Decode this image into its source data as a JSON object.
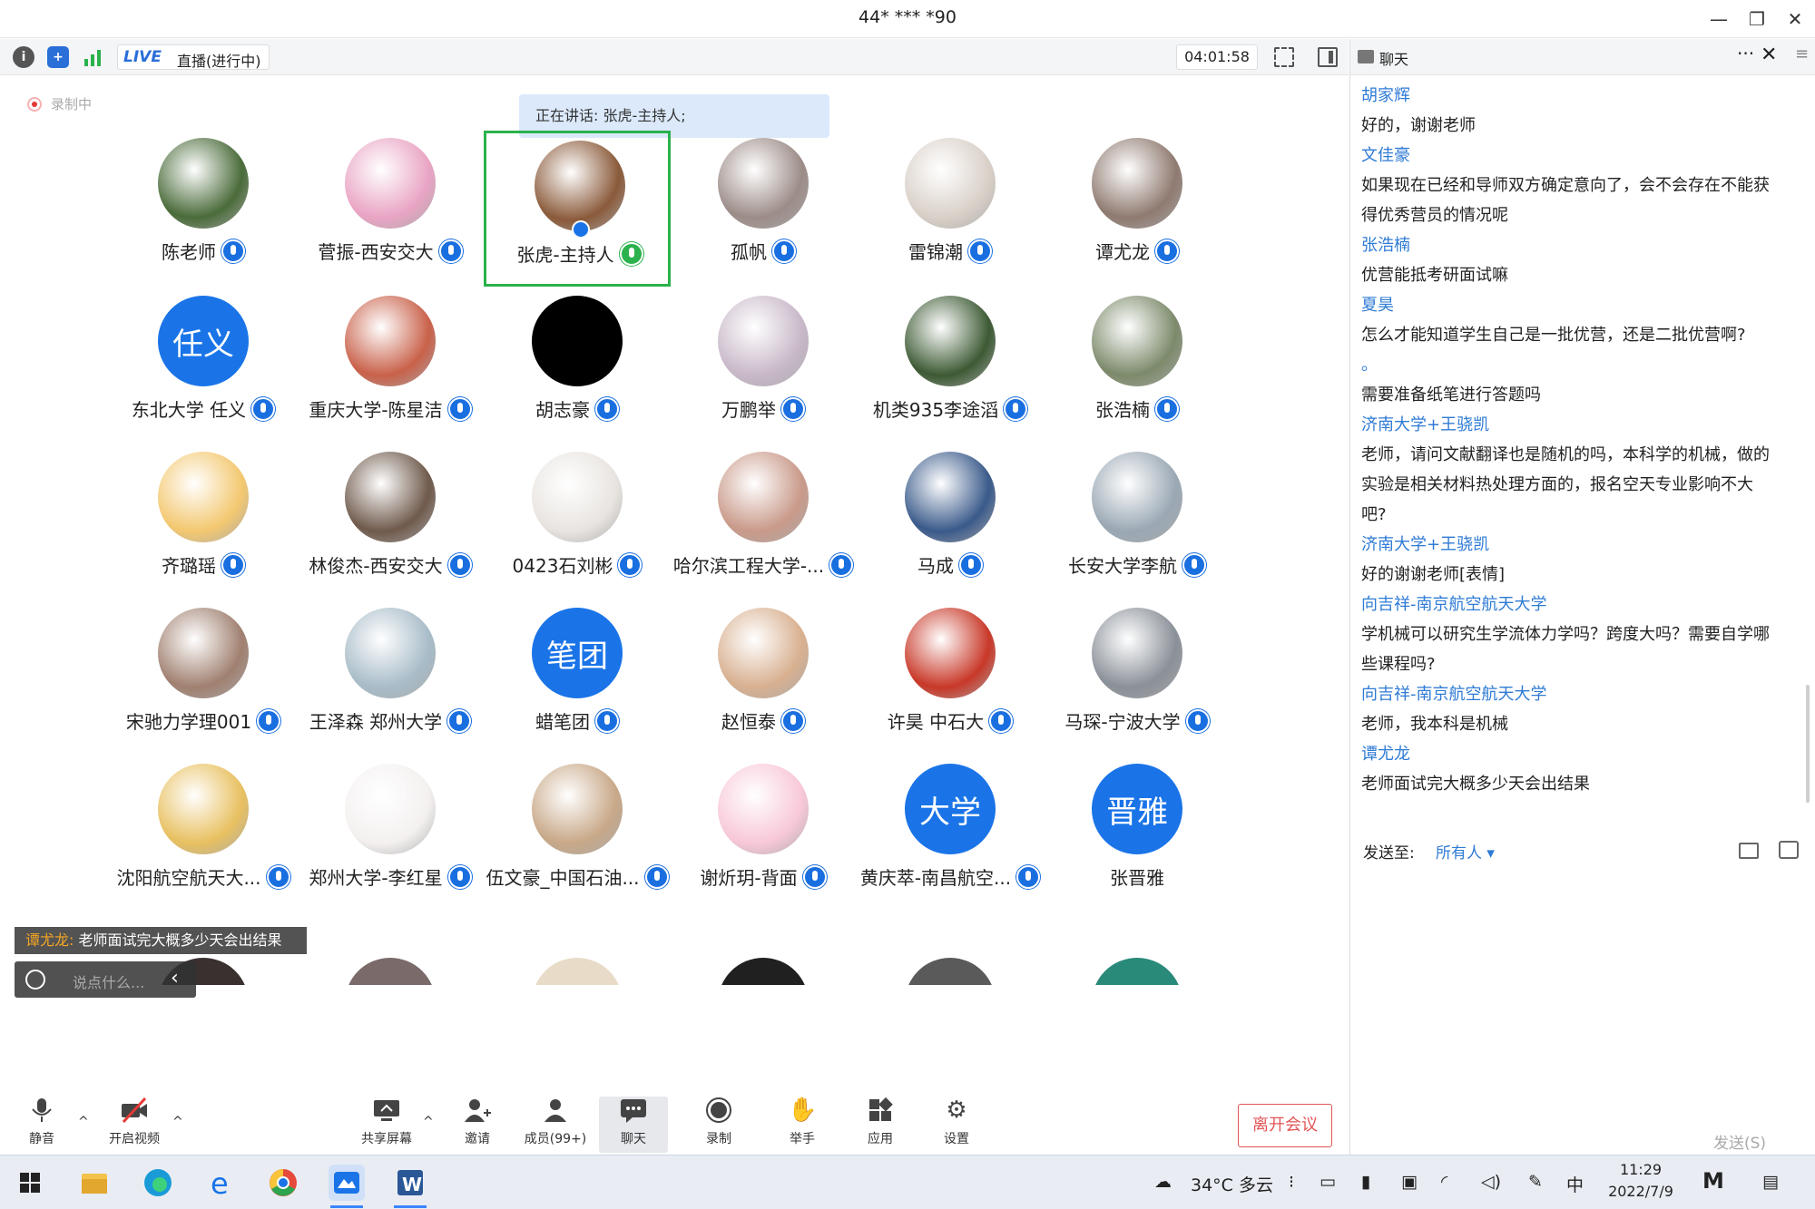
{
  "window": {
    "title": "44* *** *90",
    "min": "—",
    "max": "❐",
    "close": "✕"
  },
  "toolbar": {
    "live": "LIVE",
    "live_status": "直播(进行中)",
    "timer": "04:01:58"
  },
  "recording_label": "录制中",
  "speaking": "正在讲话: 张虎-主持人;",
  "participants": [
    {
      "name": "陈老师",
      "avatar": "photo",
      "color": "#4a6b3a"
    },
    {
      "name": "菅振-西安交大",
      "avatar": "photo",
      "color": "#e9a4c4"
    },
    {
      "name": "张虎-主持人",
      "avatar": "photo",
      "color": "#8a5a3a"
    },
    {
      "name": "孤帆",
      "avatar": "photo",
      "color": "#9c8c88"
    },
    {
      "name": "雷锦潮",
      "avatar": "photo",
      "color": "#d9d0c8"
    },
    {
      "name": "谭尤龙",
      "avatar": "photo",
      "color": "#8f7a70"
    },
    {
      "name": "东北大学 任义",
      "avatar": "text",
      "avatar_text": "任义"
    },
    {
      "name": "重庆大学-陈星洁",
      "avatar": "photo",
      "color": "#c9614a"
    },
    {
      "name": "胡志豪",
      "avatar": "black"
    },
    {
      "name": "万鹏举",
      "avatar": "photo",
      "color": "#c8b8c8"
    },
    {
      "name": "机类935李途滔",
      "avatar": "photo",
      "color": "#3d5a34"
    },
    {
      "name": "张浩楠",
      "avatar": "photo",
      "color": "#7c8a6a"
    },
    {
      "name": "齐璐瑶",
      "avatar": "photo",
      "color": "#f3c870"
    },
    {
      "name": "林俊杰-西安交大",
      "avatar": "photo",
      "color": "#6f5a4c"
    },
    {
      "name": "0423石刘彬",
      "avatar": "photo",
      "color": "#e8e4e0"
    },
    {
      "name": "哈尔滨工程大学-...",
      "avatar": "photo",
      "color": "#c99a8a"
    },
    {
      "name": "马成",
      "avatar": "photo",
      "color": "#3a5a8a"
    },
    {
      "name": "长安大学李航",
      "avatar": "photo",
      "color": "#9aa8b4"
    },
    {
      "name": "宋驰力学理001",
      "avatar": "photo",
      "color": "#a08070"
    },
    {
      "name": "王泽森 郑州大学",
      "avatar": "photo",
      "color": "#a8bcc8"
    },
    {
      "name": "蜡笔团",
      "avatar": "text",
      "avatar_text": "笔团"
    },
    {
      "name": "赵恒泰",
      "avatar": "photo",
      "color": "#d8b090"
    },
    {
      "name": "许昊 中石大",
      "avatar": "photo",
      "color": "#c83828"
    },
    {
      "name": "马琛-宁波大学",
      "avatar": "photo",
      "color": "#8a9098"
    },
    {
      "name": "沈阳航空航天大...",
      "avatar": "photo",
      "color": "#e8c060"
    },
    {
      "name": "郑州大学-李红星",
      "avatar": "photo",
      "color": "#f4f0f0"
    },
    {
      "name": "伍文豪_中国石油...",
      "avatar": "photo",
      "color": "#c8a888"
    },
    {
      "name": "谢炘玥-背面",
      "avatar": "photo",
      "color": "#f8c8d8"
    },
    {
      "name": "黄庆萃-南昌航空...",
      "avatar": "text",
      "avatar_text": "大学"
    },
    {
      "name": "张晋雅",
      "avatar": "text",
      "avatar_text": "晋雅",
      "no_mic": true
    }
  ],
  "toast": {
    "user": "谭尤龙:",
    "text": " 老师面试完大概多少天会出结果"
  },
  "quick_input_placeholder": "说点什么...",
  "bottombar": {
    "mute": "静音",
    "video": "开启视频",
    "share": "共享屏幕",
    "invite": "邀请",
    "members": "成员(99+)",
    "chat": "聊天",
    "record": "录制",
    "raise": "举手",
    "apps": "应用",
    "settings": "设置",
    "leave": "离开会议"
  },
  "chat": {
    "title": "聊天",
    "messages": [
      {
        "user": "胡家辉",
        "lines": [
          "好的，谢谢老师"
        ]
      },
      {
        "user": "文佳豪",
        "lines": [
          "如果现在已经和导师双方确定意向了，会不会存在不能获",
          "得优秀营员的情况呢"
        ]
      },
      {
        "user": "张浩楠",
        "lines": [
          "优营能抵考研面试嘛"
        ]
      },
      {
        "user": "夏昊",
        "lines": [
          "怎么才能知道学生自己是一批优营，还是二批优营啊?"
        ]
      },
      {
        "user": "。",
        "lines": [
          "需要准备纸笔进行答题吗"
        ]
      },
      {
        "user": "济南大学+王骁凯",
        "lines": [
          "老师，请问文献翻译也是随机的吗，本科学的机械，做的",
          "实验是相关材料热处理方面的，报名空天专业影响不大",
          "吧?"
        ]
      },
      {
        "user": "济南大学+王骁凯",
        "lines": [
          "好的谢谢老师[表情]"
        ]
      },
      {
        "user": "向吉祥-南京航空航天大学",
        "lines": [
          "学机械可以研究生学流体力学吗？跨度大吗？需要自学哪",
          "些课程吗?"
        ]
      },
      {
        "user": "向吉祥-南京航空航天大学",
        "lines": [
          "老师，我本科是机械"
        ]
      },
      {
        "user": "谭尤龙",
        "lines": [
          "老师面试完大概多少天会出结果"
        ]
      }
    ],
    "send_to_label": "发送至:",
    "send_to_value": "所有人 ▾",
    "send_button": "发送(S)"
  },
  "taskbar": {
    "weather": "34°C 多云",
    "ime": "中",
    "time": "11:29",
    "date": "2022/7/9"
  },
  "colors": {
    "accent": "#1a74e8",
    "speaking": "#2bb24c",
    "chat_user": "#2f7bd5",
    "leave": "#e25555"
  }
}
